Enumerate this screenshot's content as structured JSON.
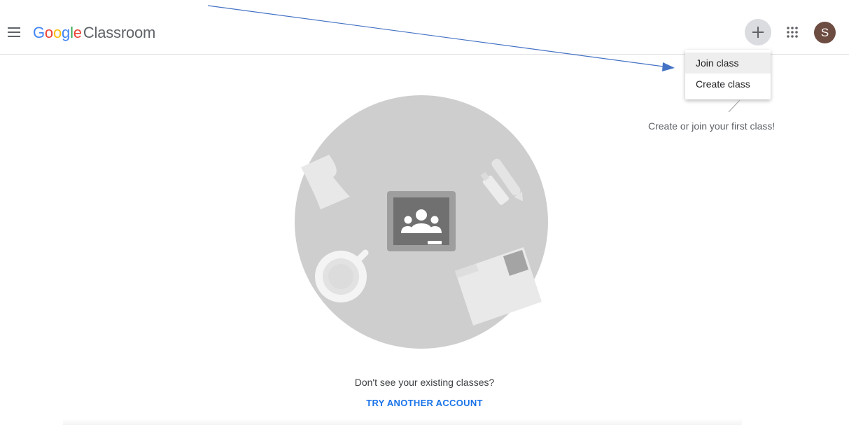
{
  "header": {
    "logo_google": [
      "G",
      "o",
      "o",
      "g",
      "l",
      "e"
    ],
    "logo_product": "Classroom",
    "logo_colors": [
      "#4285F4",
      "#EA4335",
      "#FBBC05",
      "#4285F4",
      "#34A853",
      "#EA4335"
    ],
    "plus_icon": "plus-icon",
    "apps_icon": "apps-grid-icon",
    "avatar_letter": "S",
    "avatar_color": "#6d4c41"
  },
  "menu": {
    "items": [
      {
        "label": "Join class",
        "active": true
      },
      {
        "label": "Create class",
        "active": false
      }
    ]
  },
  "hint": "Create or join your first class!",
  "empty_state": {
    "illustration": "classroom-desk-illustration",
    "message": "Don't see your existing classes?",
    "link": "TRY ANOTHER ACCOUNT"
  },
  "annotation": {
    "arrow_color": "#4472C4"
  }
}
